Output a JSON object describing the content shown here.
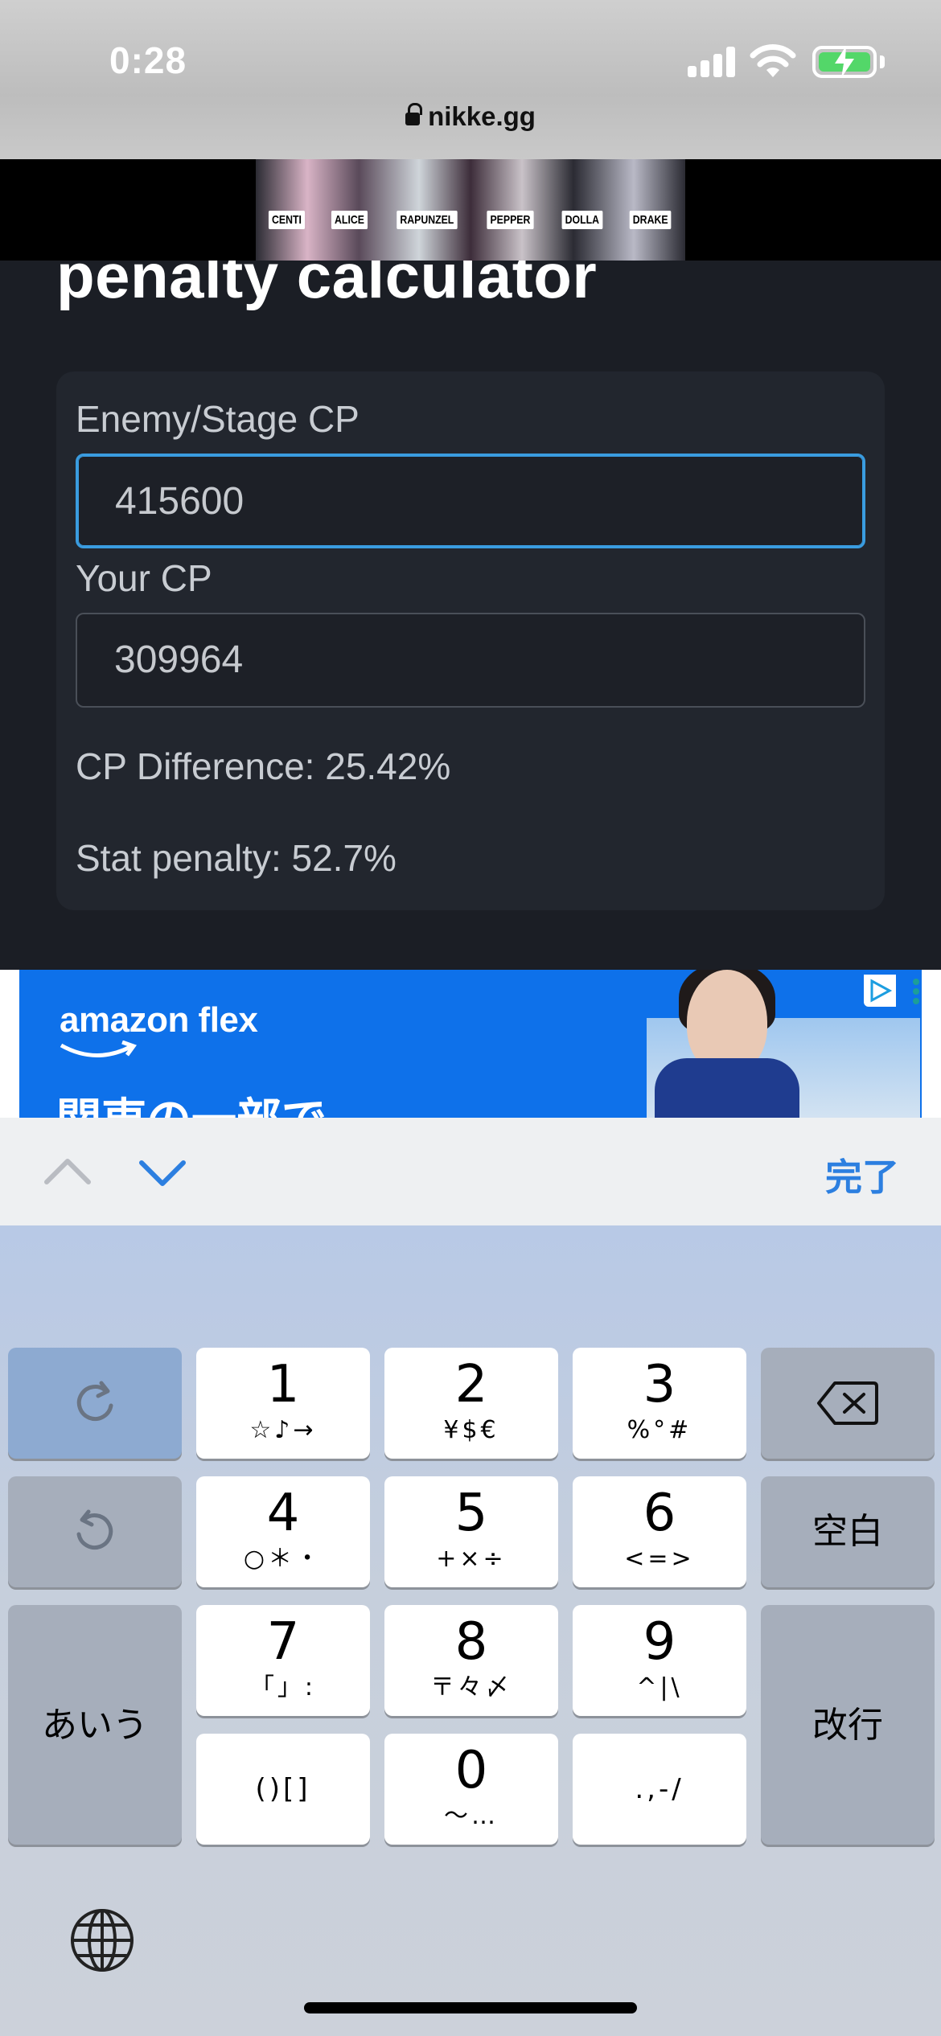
{
  "status_bar": {
    "time": "0:28",
    "icons": [
      "cellular-signal-icon",
      "wifi-icon",
      "battery-charging-icon"
    ],
    "battery_color": "#53d769"
  },
  "browser": {
    "url": "nikke.gg",
    "lock_icon": "lock-icon"
  },
  "top_banner": {
    "names": [
      "CENTI",
      "ALICE",
      "RAPUNZEL",
      "PEPPER",
      "DOLLA",
      "DRAKE"
    ]
  },
  "page": {
    "title": "penalty calculator",
    "enemy_label": "Enemy/Stage CP",
    "enemy_value": "415600",
    "your_label": "Your CP",
    "your_value": "309964",
    "cp_difference": "CP Difference: 25.42%",
    "stat_penalty": "Stat penalty: 52.7%",
    "focus_color": "#3a9ce0"
  },
  "ad": {
    "brand": "amazon flex",
    "headline": "関東の一部で",
    "bg_color": "#0e71ea",
    "adchoices_icon": "adchoices-icon",
    "menu_icon": "more-vertical-icon"
  },
  "accessory": {
    "prev_icon": "chevron-up-icon",
    "next_icon": "chevron-down-icon",
    "done": "完了",
    "done_color": "#2c7fe0"
  },
  "keyboard": {
    "keys": [
      {
        "main": "1",
        "sub": "☆♪→"
      },
      {
        "main": "2",
        "sub": "¥$€"
      },
      {
        "main": "3",
        "sub": "%°#"
      },
      {
        "main": "4",
        "sub": "○＊・"
      },
      {
        "main": "5",
        "sub": "+×÷"
      },
      {
        "main": "6",
        "sub": "<=>"
      },
      {
        "main": "7",
        "sub": "「」:"
      },
      {
        "main": "8",
        "sub": "〒々〆"
      },
      {
        "main": "9",
        "sub": "^|\\"
      },
      {
        "main": "",
        "sub": "()[]"
      },
      {
        "main": "0",
        "sub": "〜…"
      },
      {
        "main": "",
        "sub": ".,-/"
      }
    ],
    "space": "空白",
    "kana": "あいう",
    "return": "改行",
    "icons": [
      "redo-icon",
      "undo-icon",
      "delete-icon",
      "globe-icon"
    ]
  }
}
